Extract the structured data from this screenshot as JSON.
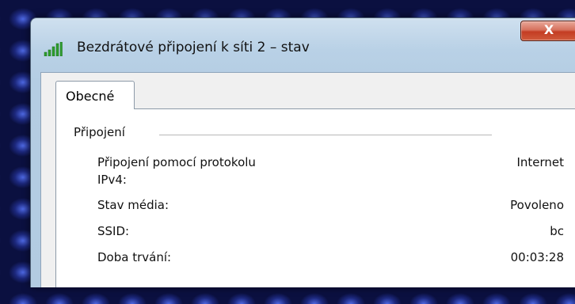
{
  "window": {
    "title": "Bezdrátové připojení k síti 2 – stav",
    "close_label": "X",
    "icon": "wireless-signal-icon"
  },
  "tabs": [
    {
      "label": "Obecné",
      "active": true
    }
  ],
  "connection": {
    "group_title": "Připojení",
    "rows": [
      {
        "label": "Připojení pomocí protokolu IPv4:",
        "value": "Internet"
      },
      {
        "label": "Stav média:",
        "value": "Povoleno"
      },
      {
        "label": "SSID:",
        "value": "bc"
      },
      {
        "label": "Doba trvání:",
        "value": "00:03:28"
      }
    ]
  },
  "colors": {
    "close_button": "#c43c23",
    "signal_bars": "#2e9e2e",
    "title_bar": "#b9d1e6"
  }
}
